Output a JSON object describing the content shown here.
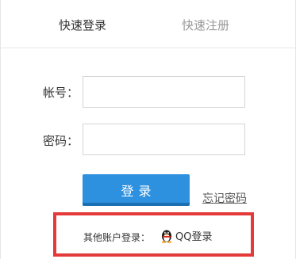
{
  "tabs": {
    "login": "快速登录",
    "register": "快速注册"
  },
  "form": {
    "account_label": "帐号：",
    "account_value": "",
    "password_label": "密码：",
    "password_value": ""
  },
  "actions": {
    "login_button": "登录",
    "forgot_password": "忘记密码"
  },
  "other_login": {
    "label": "其他账户登录：",
    "qq_label": "QQ登录",
    "qq_icon": "qq-penguin-icon"
  },
  "colors": {
    "button_blue": "#2e91df",
    "highlight_red": "#e43a3a",
    "active_tab_text": "#333333",
    "inactive_tab_text": "#999999"
  }
}
